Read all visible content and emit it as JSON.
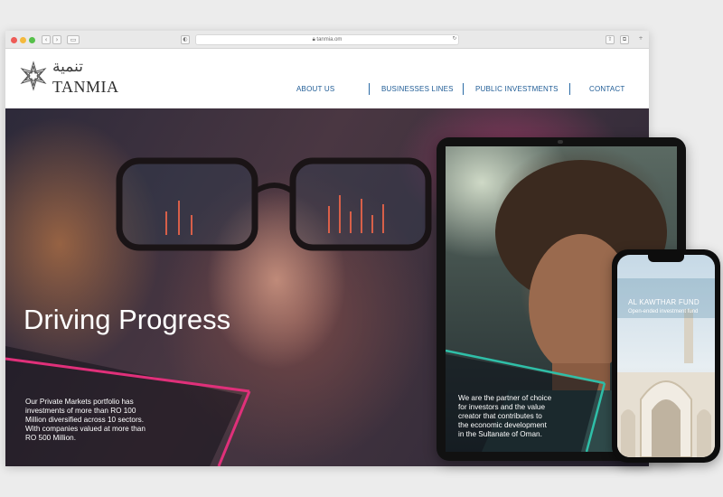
{
  "browser": {
    "url": "tanmia.om"
  },
  "logo": {
    "arabic": "تنمية",
    "name": "TANMIA"
  },
  "nav": {
    "items": [
      {
        "label": "ABOUT US"
      },
      {
        "label": "BUSINESSES LINES"
      },
      {
        "label": "PUBLIC INVESTMENTS"
      },
      {
        "label": "CONTACT"
      }
    ]
  },
  "hero": {
    "title": "Driving Progress",
    "body_lines": [
      "Our Private Markets portfolio has",
      "investments of more than RO 100",
      "Million diversified across 10 sectors.",
      "With companies valued at more than",
      "RO 500 Million."
    ]
  },
  "tablet": {
    "lines": [
      "We are the partner of choice",
      "for investors and the value",
      "creator that contributes to",
      "the economic development",
      "in the Sultanate of Oman."
    ]
  },
  "phone": {
    "title": "AL KAWTHAR FUND",
    "subtitle": "Open-ended investment fund"
  },
  "colors": {
    "accent_pink": "#e0307a",
    "accent_teal": "#2fbfa8",
    "nav_blue": "#1e5b95"
  }
}
